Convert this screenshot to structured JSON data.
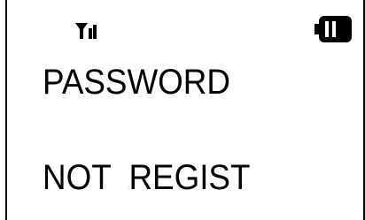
{
  "status_bar": {
    "signal_icon": "signal-antenna-icon",
    "battery_icon": "battery-full-icon"
  },
  "display": {
    "line1": "PASSWORD",
    "line2": "NOT  REGIST"
  }
}
